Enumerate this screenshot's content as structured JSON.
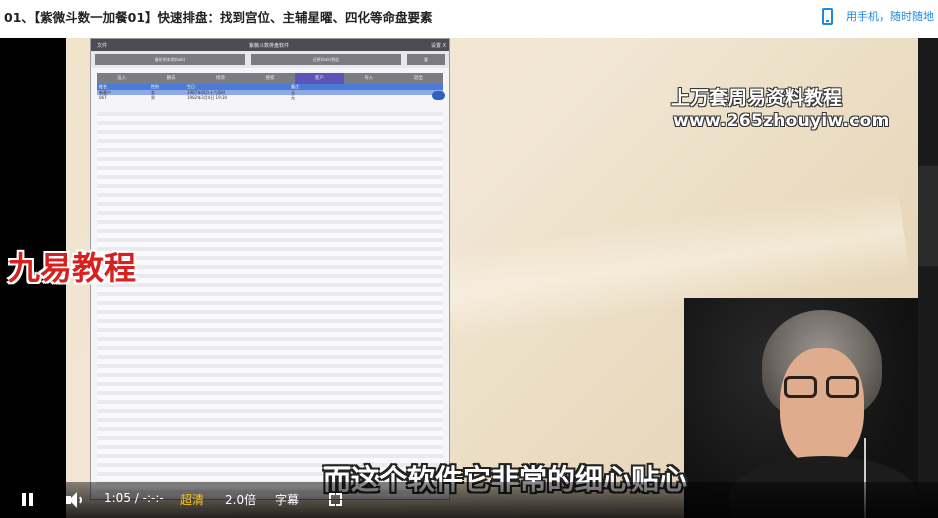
{
  "page": {
    "title": "01、【紫微斗数一加餐01】快速排盘：找到宫位、主辅星曜、四化等命盘要素",
    "mobile_link": "用手机，随时随地"
  },
  "software": {
    "window_title": "紫薇斗数排盘软件",
    "window_menu": "设置 X",
    "window_left": "文件",
    "buttons": [
      "备份到本地(bak)",
      "还原(bak)到此",
      "重"
    ],
    "tabs": [
      "设入",
      "删去",
      "修改",
      "搜索",
      "客户",
      "导入",
      "退出"
    ],
    "active_tab": 4,
    "table_headers": [
      "姓名",
      "性别",
      "生日",
      "备注"
    ],
    "rows": [
      [
        "新客户",
        "女",
        "1987年四月十六酉时",
        "无"
      ],
      [
        "067",
        "男",
        "1982年3月4日 19:30",
        "无"
      ]
    ]
  },
  "watermarks": {
    "line1": "上万套周易资料教程",
    "line2": "www.265zhouyiw.com",
    "logo": "九易教程"
  },
  "subtitle": "而这个软件它非常的细心贴心",
  "controls": {
    "time": "1:05 / -:-:-",
    "quality": "超清",
    "speed": "2.0倍",
    "captions": "字幕",
    "quality_color": "#f5c518"
  }
}
